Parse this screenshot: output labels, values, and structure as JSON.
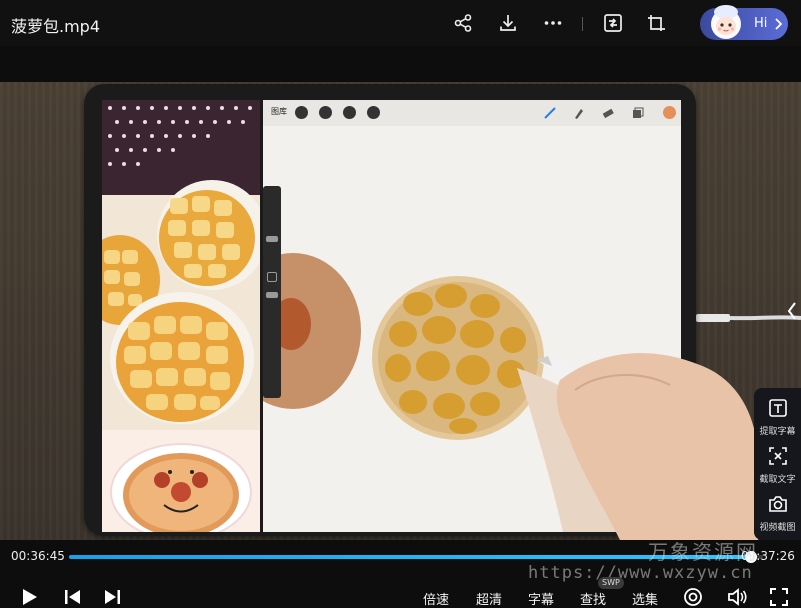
{
  "window": {
    "title": "菠萝包.mp4"
  },
  "header": {
    "share_icon": "share-icon",
    "download_icon": "download-icon",
    "more_icon": "more-icon",
    "screen_icon": "screen-cast-icon",
    "mini_icon": "mini-window-icon",
    "assistant": {
      "label": "Hi",
      "icon": "assistant-avatar"
    }
  },
  "video": {
    "description_icons": [
      "procreate-gallery",
      "brush-icon",
      "smudge-icon",
      "eraser-icon",
      "layers-icon",
      "color-icon"
    ],
    "procreate_gallery_label": "图库"
  },
  "side_panel": {
    "items": [
      {
        "label": "提取字幕",
        "icon": "subtitle-extract-icon"
      },
      {
        "label": "截取文字",
        "icon": "text-capture-icon"
      },
      {
        "label": "视频截图",
        "icon": "camera-icon"
      }
    ]
  },
  "player": {
    "current_time": "00:36:45",
    "end_time": "00:37:26",
    "progress": 0.982,
    "controls": {
      "play": "play-icon",
      "prev": "previous-icon",
      "next": "next-icon",
      "speed": "倍速",
      "quality": "超清",
      "subtitle": "字幕",
      "search": "查找",
      "episodes": "选集",
      "search_badge": "SWP"
    }
  },
  "watermark": {
    "line1": "万象资源网",
    "line2": "https://www.wxzyw.cn"
  },
  "colors": {
    "accent": "#18a0e8",
    "background": "#0d0d0d"
  }
}
